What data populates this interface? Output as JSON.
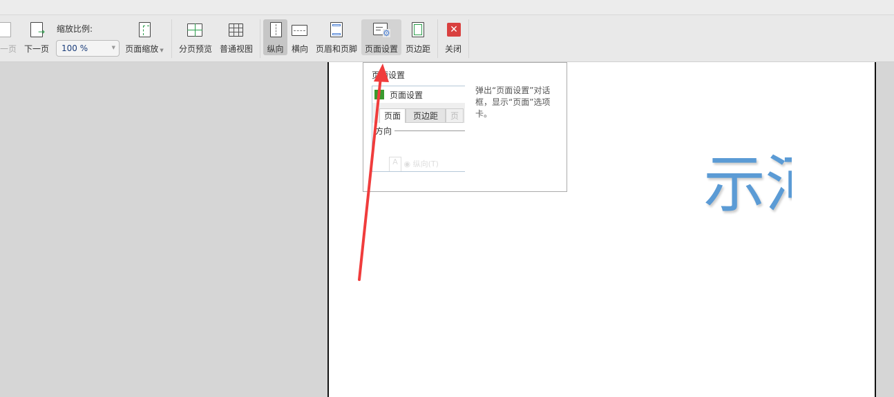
{
  "toolbar": {
    "prev_page": "上一页",
    "next_page": "下一页",
    "zoom_label": "缩放比例:",
    "zoom_value": "100 %",
    "page_zoom": "页面缩放",
    "page_break_preview": "分页预览",
    "normal_view": "普通视图",
    "portrait": "纵向",
    "landscape": "横向",
    "header_footer": "页眉和页脚",
    "page_setup": "页面设置",
    "margins": "页边距",
    "close": "关闭"
  },
  "tooltip": {
    "title": "页面设置",
    "preview_title": "页面设置",
    "preview_tabs": [
      "页面",
      "页边距",
      "页"
    ],
    "preview_section": "方向",
    "preview_option": "纵向(T)",
    "description": "弹出“页面设置”对话框，显示“页面”选项卡。"
  },
  "document": {
    "watermark_text": "示",
    "watermark_text_partial": "河"
  },
  "colors": {
    "accent_blue": "#5b9bd5",
    "close_red": "#d9403f",
    "arrow_red": "#f03c3c"
  }
}
